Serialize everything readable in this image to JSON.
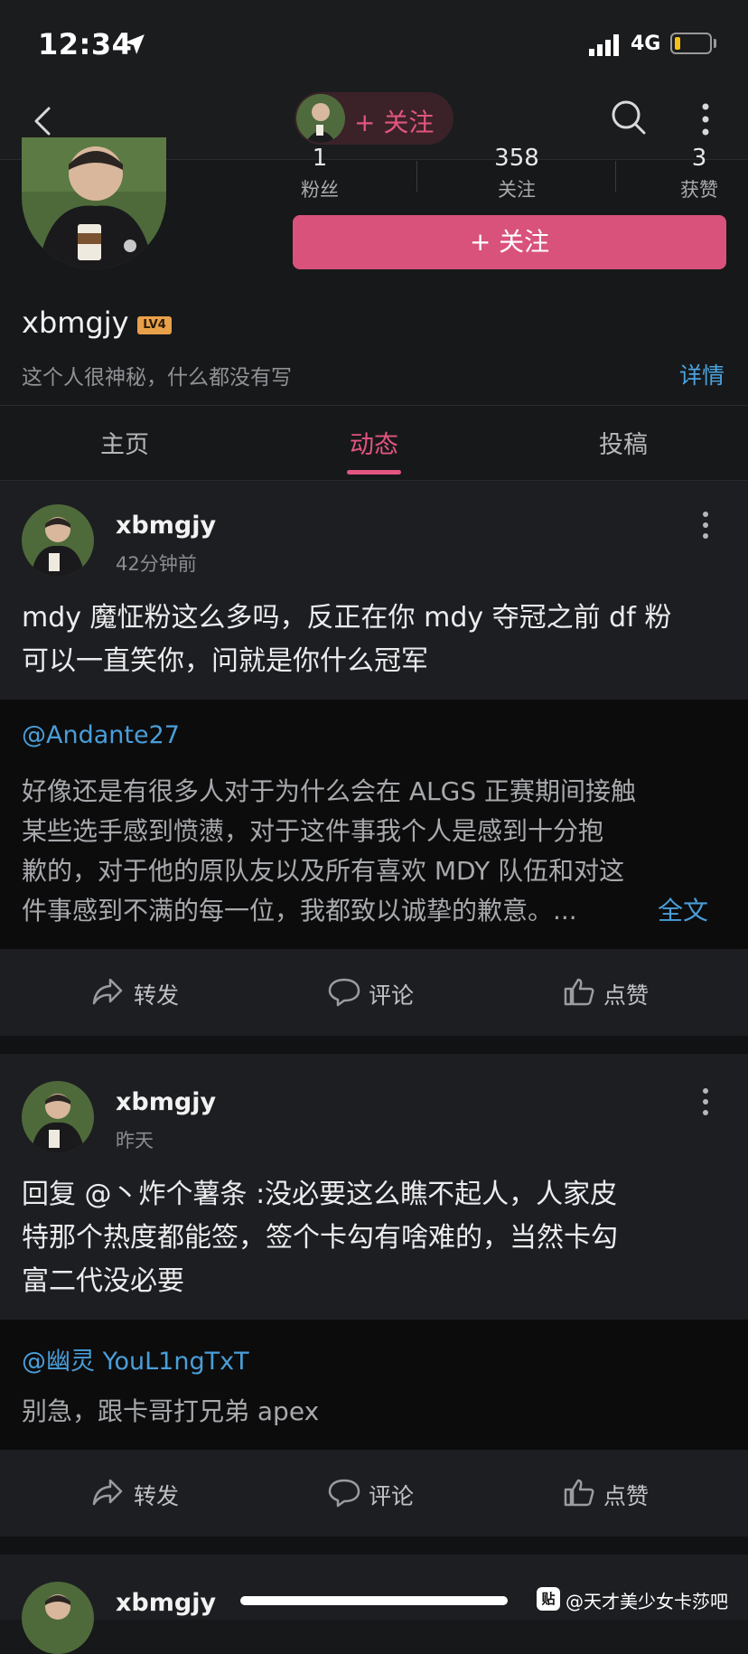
{
  "status_bar": {
    "time": "12:34",
    "network": "4G"
  },
  "nav": {
    "follow_label": "+ 关注"
  },
  "profile": {
    "stats": [
      {
        "value": "1",
        "label": "粉丝"
      },
      {
        "value": "358",
        "label": "关注"
      },
      {
        "value": "3",
        "label": "获赞"
      }
    ],
    "follow_button": "+ 关注",
    "username": "xbmgjy",
    "level_badge": "LV4",
    "bio": "这个人很神秘，什么都没有写",
    "detail_link": "详情"
  },
  "tabs": [
    {
      "label": "主页",
      "active": false
    },
    {
      "label": "动态",
      "active": true
    },
    {
      "label": "投稿",
      "active": false
    }
  ],
  "posts": [
    {
      "user": "xbmgjy",
      "time": "42分钟前",
      "text_lines": [
        "mdy 魔怔粉这么多吗，反正在你 mdy 夺冠之前 df 粉",
        "可以一直笑你，问就是你什么冠军"
      ],
      "quote": {
        "user": "@Andante27",
        "text_lines": [
          "好像还是有很多人对于为什么会在 ALGS 正赛期间接触",
          "某些选手感到愤懑，对于这件事我个人是感到十分抱",
          "歉的，对于他的原队友以及所有喜欢 MDY 队伍和对这",
          "件事感到不满的每一位，我都致以诚挚的歉意。..."
        ],
        "more_label": "全文"
      },
      "actions": {
        "repost": "转发",
        "comment": "评论",
        "like": "点赞"
      }
    },
    {
      "user": "xbmgjy",
      "time": "昨天",
      "text_lines": [
        "回复 @丶炸个薯条 :没必要这么瞧不起人，人家皮",
        "特那个热度都能签，签个卡勾有啥难的，当然卡勾",
        "富二代没必要"
      ],
      "quote": {
        "user": "@幽灵 YouL1ngTxT",
        "text_lines": [
          "别急，跟卡哥打兄弟 apex"
        ]
      },
      "actions": {
        "repost": "转发",
        "comment": "评论",
        "like": "点赞"
      }
    },
    {
      "user": "xbmgjy"
    }
  ],
  "watermark": {
    "logo": "贴",
    "text": "@天才美少女卡莎吧"
  },
  "colors": {
    "accent": "#d8527c",
    "link": "#4a9ed8",
    "background": "#17181a"
  }
}
